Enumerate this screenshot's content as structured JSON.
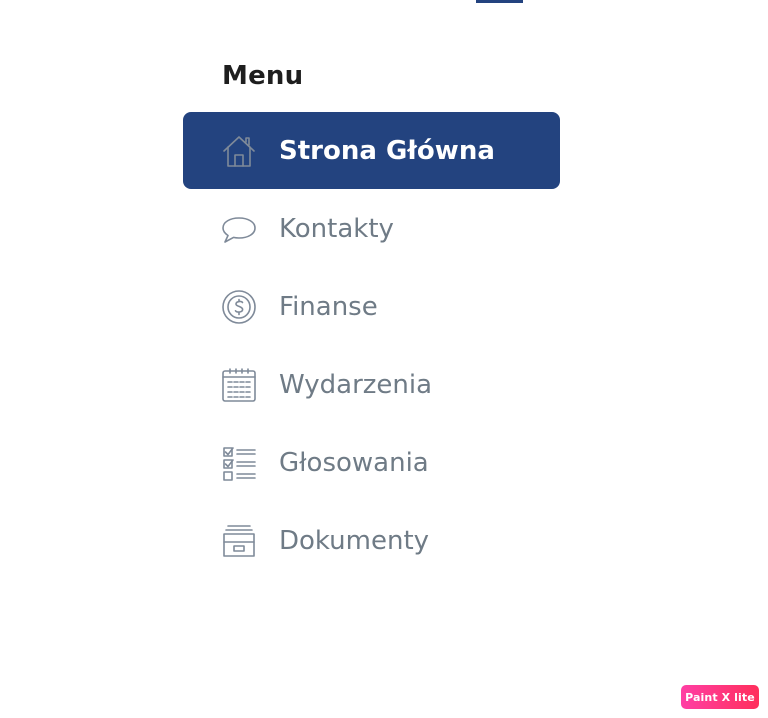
{
  "menu": {
    "heading": "Menu",
    "items": [
      {
        "label": "Strona Główna",
        "icon": "home-icon",
        "active": true
      },
      {
        "label": "Kontakty",
        "icon": "speech-bubble-icon",
        "active": false
      },
      {
        "label": "Finanse",
        "icon": "coin-icon",
        "active": false
      },
      {
        "label": "Wydarzenia",
        "icon": "calendar-icon",
        "active": false
      },
      {
        "label": "Głosowania",
        "icon": "checklist-icon",
        "active": false
      },
      {
        "label": "Dokumenty",
        "icon": "archive-box-icon",
        "active": false
      }
    ]
  },
  "watermark": {
    "text": "Paint X lite"
  },
  "colors": {
    "accent": "#23437f",
    "text_muted": "#6f7b86",
    "heading": "#1e1e1e",
    "watermark_start": "#ff3fa4",
    "watermark_end": "#ff2f5c"
  }
}
